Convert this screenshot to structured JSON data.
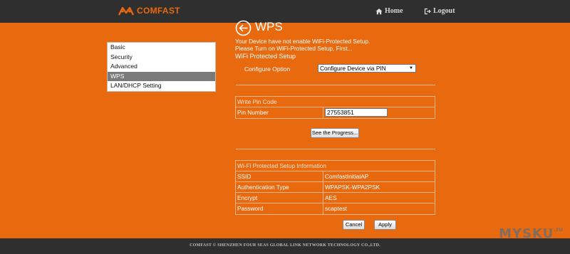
{
  "colors": {
    "page_bg": "#e8690e",
    "bar_bg": "#2f2f2f",
    "active_menu": "#7a7a7a"
  },
  "header": {
    "brand": "COMFAST",
    "logo_icon": "comfast-logo-icon",
    "nav": {
      "home": "Home",
      "logout": "Logout"
    }
  },
  "sidebar": {
    "items": [
      {
        "label": "Basic",
        "active": false
      },
      {
        "label": "Security",
        "active": false
      },
      {
        "label": "Advanced",
        "active": false
      },
      {
        "label": "WPS",
        "active": true
      },
      {
        "label": "LAN/DHCP Setting",
        "active": false
      }
    ]
  },
  "main": {
    "title": "WPS",
    "notice_line1": "Your Device have not enable WiFi-Protected Setup.",
    "notice_line2": "Please Turn on WiFi-Protected Setup, First...",
    "section_title": "WiFi Protected Setup",
    "config_option": {
      "label": "Configure Option",
      "value": "Configure Device via PIN"
    },
    "pin_section": {
      "header": "Write Pin Code",
      "pin_label": "Pin Number",
      "pin_value": "27553851"
    },
    "progress_button": "See the Progress...",
    "info_section": {
      "header": "Wi-Fi Protected Setup Information",
      "rows": [
        {
          "label": "SSID",
          "value": "ComfastInitialAP"
        },
        {
          "label": "Authentication Type",
          "value": "WPAPSK-WPA2PSK"
        },
        {
          "label": "Encrypt",
          "value": "AES"
        },
        {
          "label": "Password",
          "value": "scaptest"
        }
      ]
    },
    "buttons": {
      "cancel": "Cancel",
      "apply": "Apply"
    }
  },
  "footer": {
    "text": "COMFAST © SHENZHEN FOUR SEAS GLOBAL LINK NETWORK TECHNOLOGY CO.,LTD."
  },
  "watermark": {
    "text": "MYSKU",
    "suffix": ".ru"
  }
}
